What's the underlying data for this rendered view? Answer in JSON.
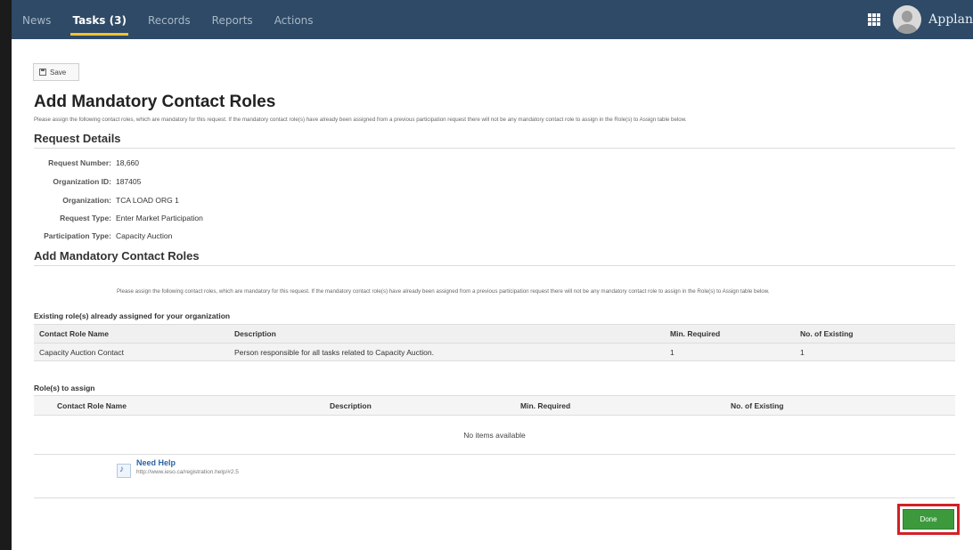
{
  "nav": {
    "items": [
      {
        "label": "News",
        "active": false
      },
      {
        "label": "Tasks (3)",
        "active": true
      },
      {
        "label": "Records",
        "active": false
      },
      {
        "label": "Reports",
        "active": false
      },
      {
        "label": "Actions",
        "active": false
      }
    ],
    "brand": "Applan",
    "accent": "#f2c230",
    "bar_color": "#2e4a66"
  },
  "toolbar": {
    "save_label": "Save"
  },
  "page": {
    "title": "Add Mandatory Contact Roles",
    "description": "Please assign the following contact roles, which are mandatory for this request. If the mandatory contact role(s) have already been assigned from a previous participation request there will not be any mandatory contact role to assign in the Role(s) to Assign table below."
  },
  "request_details": {
    "heading": "Request Details",
    "rows": [
      {
        "label": "Request Number:",
        "value": "18,660"
      },
      {
        "label": "Organization ID:",
        "value": "187405"
      },
      {
        "label": "Organization:",
        "value": "TCA LOAD ORG 1"
      },
      {
        "label": "Request Type:",
        "value": "Enter Market Participation"
      },
      {
        "label": "Participation Type:",
        "value": "Capacity Auction"
      }
    ]
  },
  "mandatory_roles": {
    "heading": "Add Mandatory Contact Roles",
    "info": "Please assign the following contact roles, which are mandatory for this request. If the mandatory contact role(s) have already been assigned from a previous participation request there will not be any mandatory contact role to assign in the Role(s) to Assign table below.",
    "existing_heading": "Existing role(s) already assigned for your organization",
    "existing_columns": [
      "Contact Role Name",
      "Description",
      "Min. Required",
      "No. of Existing"
    ],
    "existing_rows": [
      [
        "Capacity Auction Contact",
        "Person responsible for all tasks related to Capacity Auction.",
        "1",
        "1"
      ]
    ],
    "assign_heading": "Role(s) to assign",
    "assign_columns": [
      "Contact Role Name",
      "Description",
      "Min. Required",
      "No. of Existing"
    ],
    "assign_empty": "No items available"
  },
  "help": {
    "title": "Need Help",
    "url": "http://www.ieso.ca/registration.help/#2.5"
  },
  "footer": {
    "done_label": "Done",
    "done_color": "#3c9a3c",
    "highlight_color": "#d32027"
  }
}
